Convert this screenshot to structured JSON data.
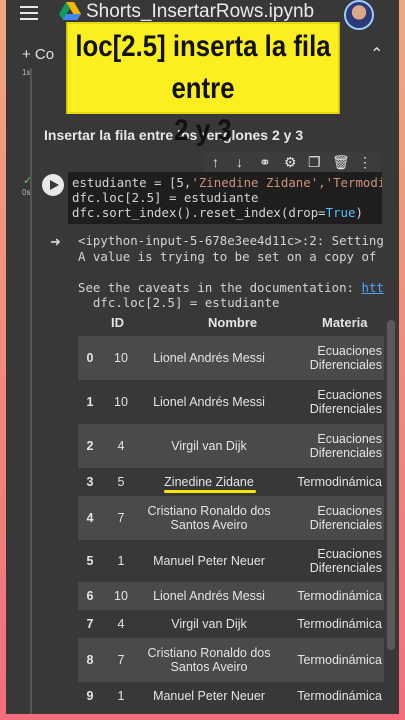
{
  "notebook": {
    "title": "Shorts_InsertarRows.ipynb",
    "add_code_label": "+ Co"
  },
  "banner": {
    "line1": "loc[2.5] inserta la fila entre",
    "line2": "2 y 3"
  },
  "cells": {
    "heading": "Insertar la fila entre los renglones 2 y 3",
    "prev_exec_time": "1s",
    "exec_time": "0s",
    "code_lines": [
      "estudiante = [5,'Zinedine Zidane','Termodiná",
      "dfc.loc[2.5] = estudiante",
      "dfc.sort_index().reset_index(drop=True)"
    ],
    "output_lines": [
      "<ipython-input-5-678e3ee4d11c>:2: Setting",
      "A value is trying to be set on a copy of",
      "",
      "See the caveats in the documentation: htt",
      "  dfc.loc[2.5] = estudiante"
    ]
  },
  "table": {
    "headers": [
      "",
      "ID",
      "Nombre",
      "Materia"
    ],
    "rows": [
      {
        "idx": "0",
        "id": "10",
        "name": "Lionel Andrés Messi",
        "materia": "Ecuaciones Diferenciales"
      },
      {
        "idx": "1",
        "id": "10",
        "name": "Lionel Andrés Messi",
        "materia": "Ecuaciones Diferenciales"
      },
      {
        "idx": "2",
        "id": "4",
        "name": "Virgil van Dijk",
        "materia": "Ecuaciones Diferenciales"
      },
      {
        "idx": "3",
        "id": "5",
        "name": "Zinedine Zidane",
        "materia": "Termodinámica"
      },
      {
        "idx": "4",
        "id": "7",
        "name": "Cristiano Ronaldo dos Santos Aveiro",
        "materia": "Ecuaciones Diferenciales"
      },
      {
        "idx": "5",
        "id": "1",
        "name": "Manuel Peter Neuer",
        "materia": "Ecuaciones Diferenciales"
      },
      {
        "idx": "6",
        "id": "10",
        "name": "Lionel Andrés Messi",
        "materia": "Termodinámica"
      },
      {
        "idx": "7",
        "id": "4",
        "name": "Virgil van Dijk",
        "materia": "Termodinámica"
      },
      {
        "idx": "8",
        "id": "7",
        "name": "Cristiano Ronaldo dos Santos Aveiro",
        "materia": "Termodinámica"
      },
      {
        "idx": "9",
        "id": "1",
        "name": "Manuel Peter Neuer",
        "materia": "Termodinámica"
      }
    ]
  },
  "icons": {
    "menu": "hamburger-icon",
    "drive": "drive-icon",
    "up": "arrow-up-icon",
    "down": "arrow-down-icon",
    "link": "link-icon",
    "settings": "gear-icon",
    "mirror": "mirror-cell-icon",
    "delete": "trash-icon",
    "more": "more-vert-icon",
    "run": "play-icon",
    "output": "output-icon"
  },
  "colors": {
    "banner": "#fcef1f",
    "highlight_underline": "#ffe600",
    "string_literal": "#ce9178",
    "keyword": "#4fc1ff"
  }
}
